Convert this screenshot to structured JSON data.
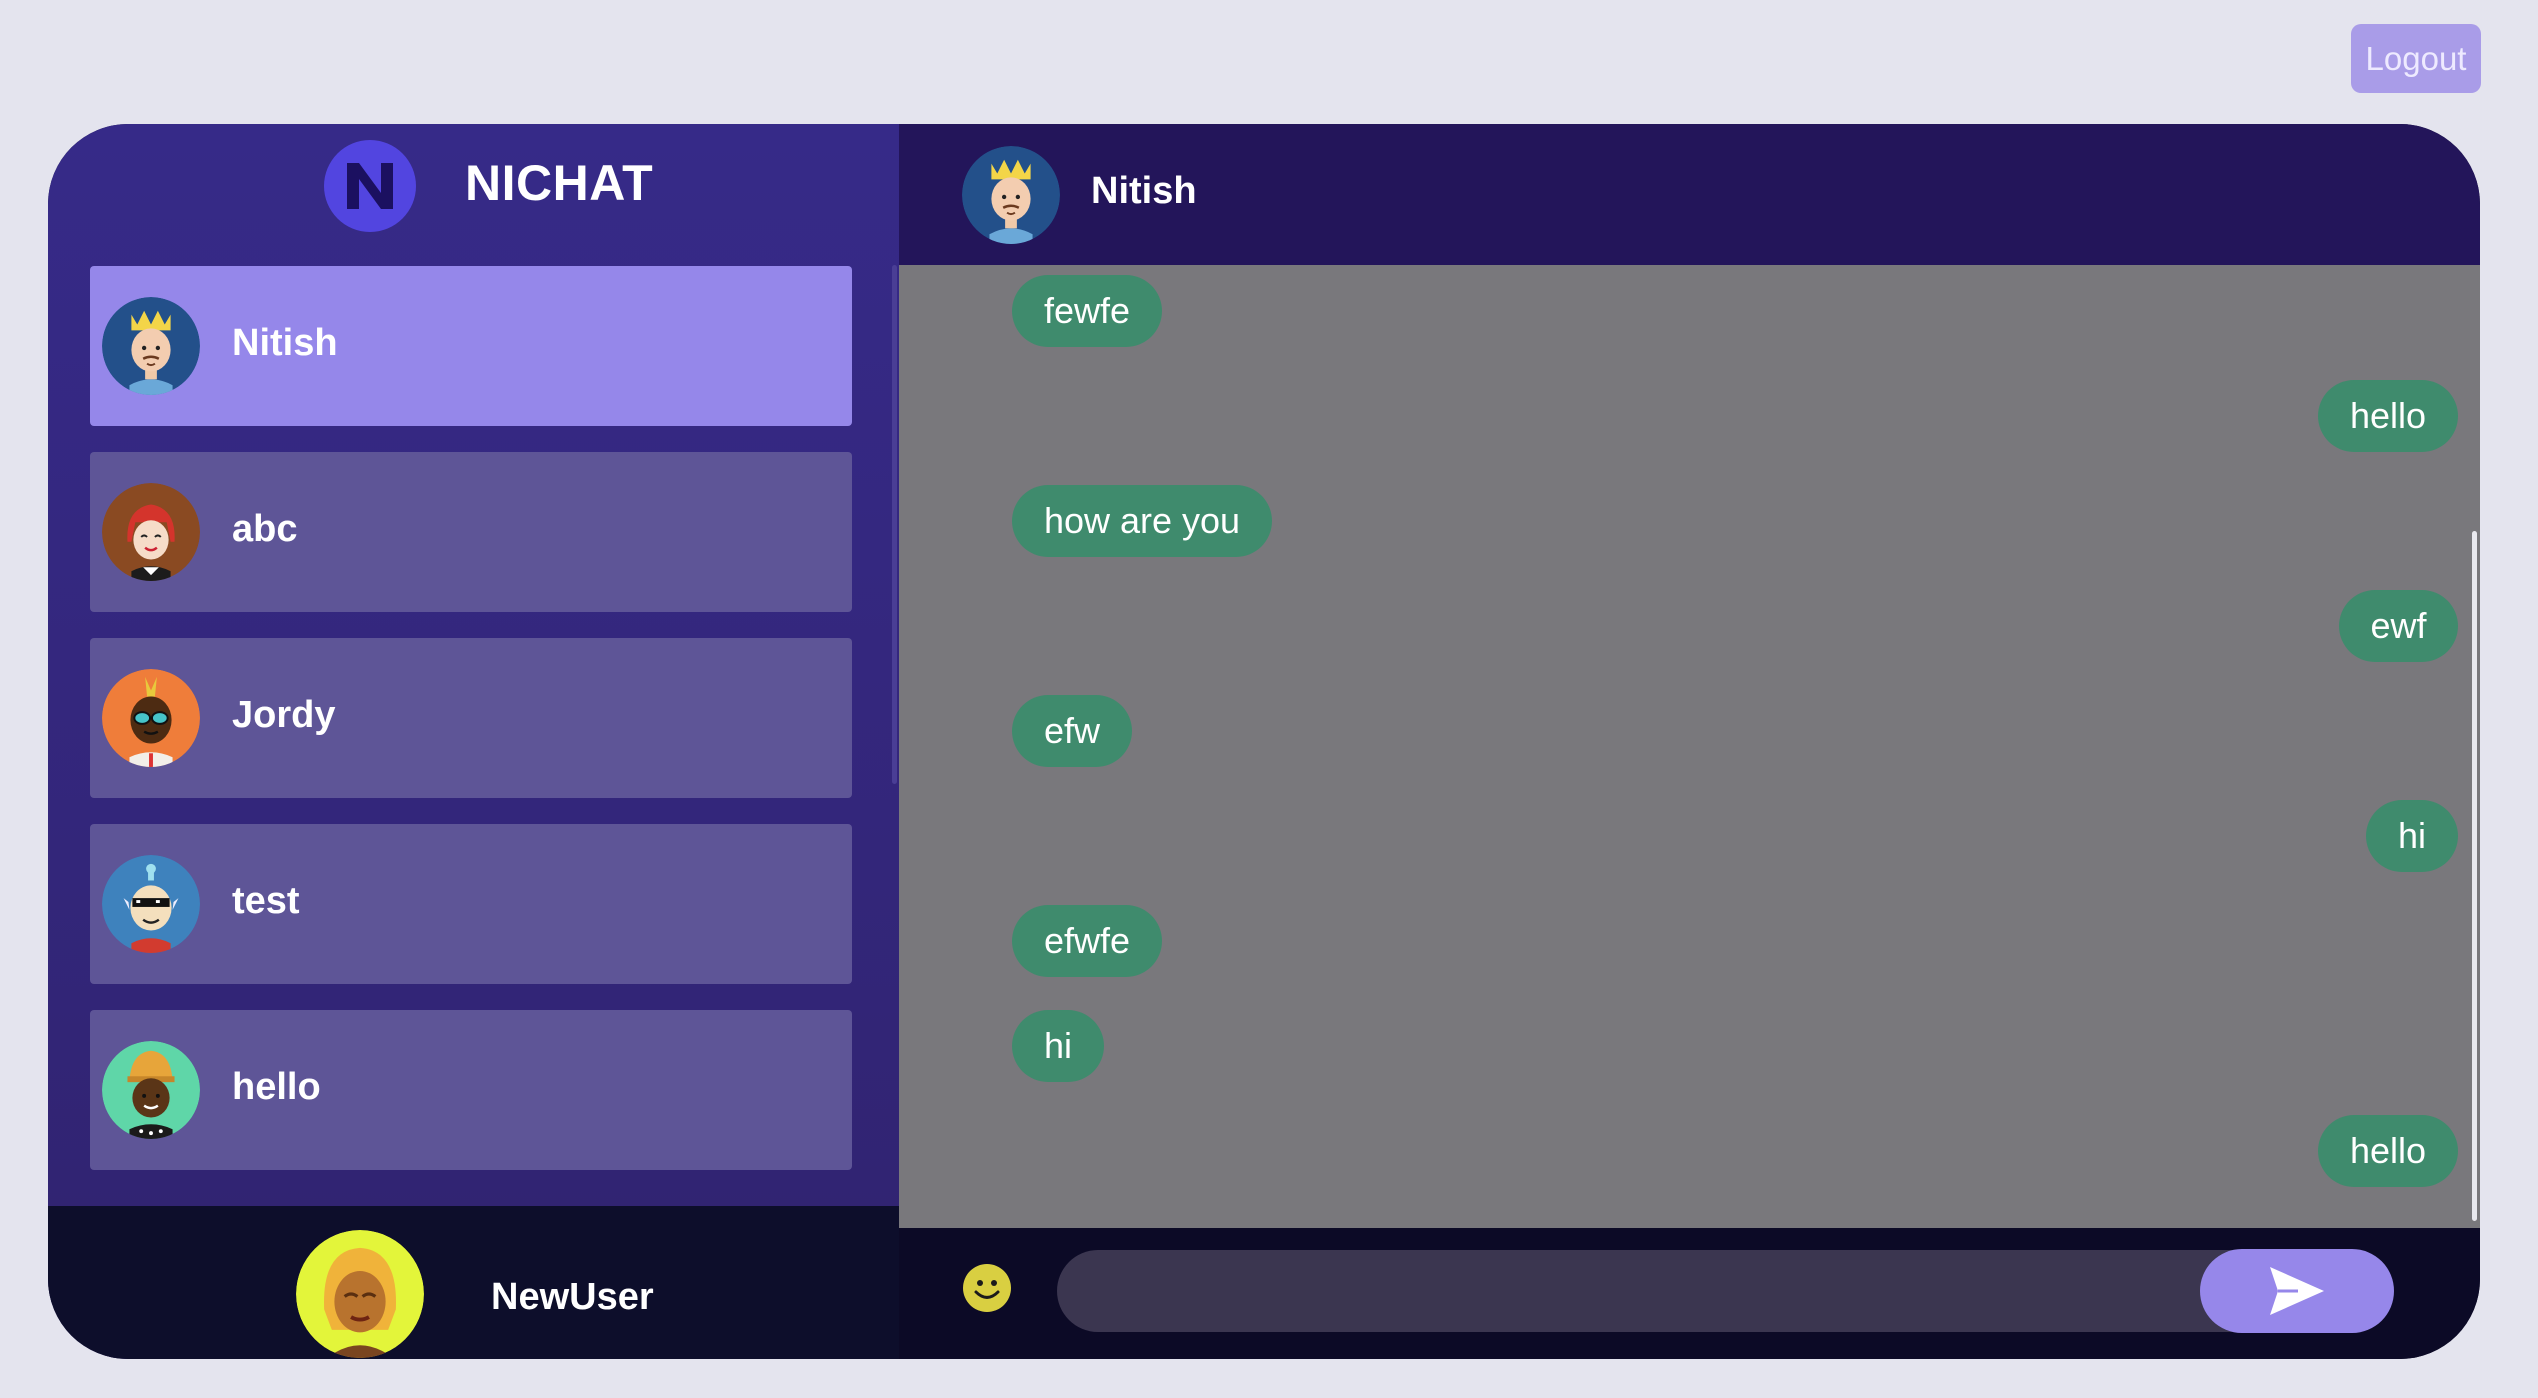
{
  "top": {
    "logout_label": "Logout"
  },
  "brand": {
    "name": "NICHAT",
    "logo_letter": "N"
  },
  "contacts": [
    {
      "name": "Nitish",
      "avatar": "king-avatar-icon",
      "active": true
    },
    {
      "name": "abc",
      "avatar": "red-hair-avatar-icon",
      "active": false
    },
    {
      "name": "Jordy",
      "avatar": "sunglasses-avatar-icon",
      "active": false
    },
    {
      "name": "test",
      "avatar": "pixel-glasses-avatar-icon",
      "active": false
    },
    {
      "name": "hello",
      "avatar": "hat-avatar-icon",
      "active": false
    }
  ],
  "current_user": {
    "name": "NewUser",
    "avatar": "blonde-avatar-icon"
  },
  "chat": {
    "header_name": "Nitish",
    "messages": [
      {
        "text": "fewfe",
        "side": "left"
      },
      {
        "text": "hello",
        "side": "right"
      },
      {
        "text": "how are you",
        "side": "left"
      },
      {
        "text": "ewf",
        "side": "right"
      },
      {
        "text": "efw",
        "side": "left"
      },
      {
        "text": "hi",
        "side": "right"
      },
      {
        "text": "efwfe",
        "side": "left"
      },
      {
        "text": "hi",
        "side": "left"
      },
      {
        "text": "hello",
        "side": "right"
      }
    ]
  },
  "composer": {
    "placeholder": "",
    "value": ""
  },
  "colors": {
    "accent": "#9687ea",
    "bubble": "#3f8b6d",
    "sidebar": "#352986",
    "contact": "#5e5597",
    "contact_active": "#9587ea",
    "messages_bg": "#79787c",
    "header_bg": "#23155a"
  }
}
